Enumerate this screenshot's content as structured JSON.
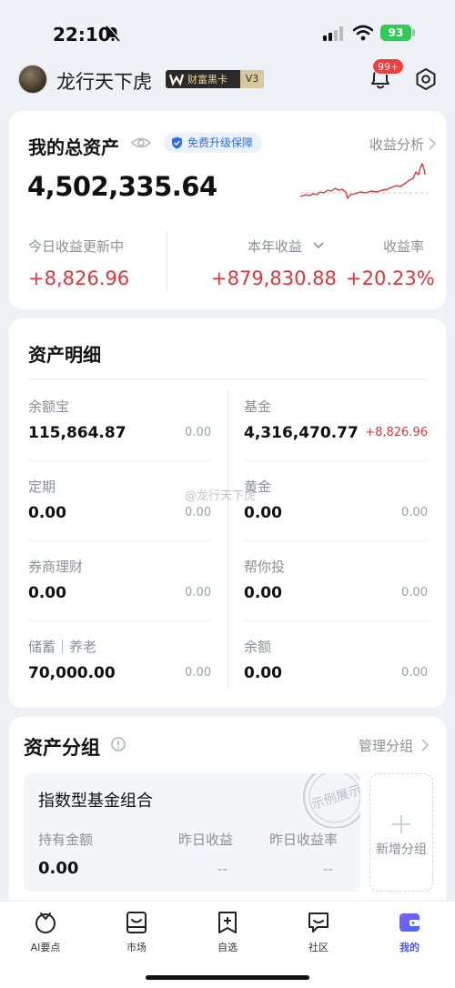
{
  "status_bar": {
    "time": "22:10",
    "battery": "93"
  },
  "header": {
    "username": "龙行天下虎",
    "card_badge": "财富黑卡",
    "level": "V3",
    "notification_count": "99+"
  },
  "total_assets": {
    "title": "我的总资产",
    "upgrade_label": "免费升级保障",
    "analysis_label": "收益分析",
    "amount": "4,502,335.64",
    "today_label": "今日收益更新中",
    "today_value": "+8,826.96",
    "year_label": "本年收益",
    "year_value": "+879,830.88",
    "rate_label": "收益率",
    "rate_value": "+20.23%"
  },
  "asset_detail": {
    "title": "资产明细",
    "items": [
      {
        "label": "余额宝",
        "value": "115,864.87",
        "change": "0.00"
      },
      {
        "label": "基金",
        "value": "4,316,470.77",
        "change": "+8,826.96"
      },
      {
        "label": "定期",
        "value": "0.00",
        "change": "0.00"
      },
      {
        "label": "黄金",
        "value": "0.00",
        "change": "0.00"
      },
      {
        "label": "券商理财",
        "value": "0.00",
        "change": "0.00"
      },
      {
        "label": "帮你投",
        "value": "0.00",
        "change": "0.00"
      },
      {
        "label": "储蓄｜养老",
        "value": "70,000.00",
        "change": "0.00"
      },
      {
        "label": "余额",
        "value": "0.00",
        "change": "0.00"
      }
    ]
  },
  "watermark": "@龙行天下虎",
  "asset_group": {
    "title": "资产分组",
    "manage_label": "管理分组",
    "combo": {
      "name": "指数型基金组合",
      "stamp": "示例展示",
      "held_label": "持有金额",
      "held_value": "0.00",
      "yday_label": "昨日收益",
      "yday_value": "--",
      "yday_rate_label": "昨日收益率",
      "yday_rate_value": "--"
    },
    "add_label": "新增分组"
  },
  "tabs": [
    {
      "label": "AI要点",
      "icon": "ai-icon"
    },
    {
      "label": "市场",
      "icon": "market-icon"
    },
    {
      "label": "自选",
      "icon": "watchlist-icon"
    },
    {
      "label": "社区",
      "icon": "community-icon"
    },
    {
      "label": "我的",
      "icon": "wallet-icon"
    }
  ],
  "colors": {
    "gain_red": "#e0353b",
    "accent_blue": "#4a57f0",
    "background": "#eef1f6"
  }
}
